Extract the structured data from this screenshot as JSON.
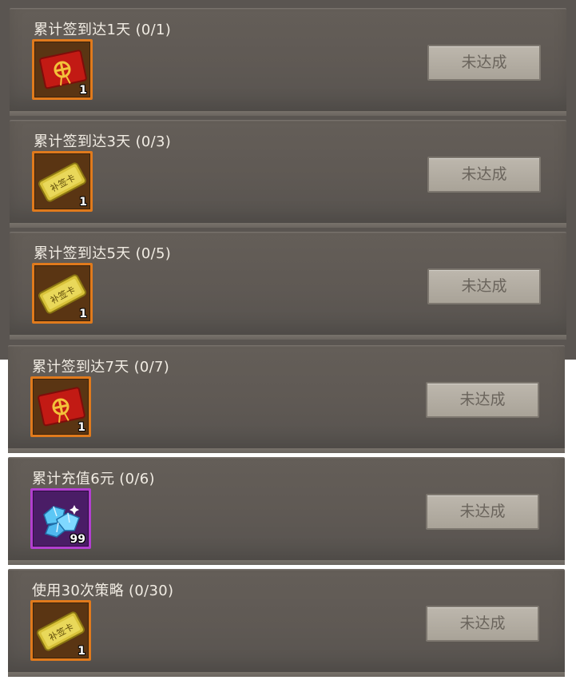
{
  "tasks": [
    {
      "title": "累计签到达1天 (0/1)",
      "reward_icon": "red-envelope-icon",
      "reward_count": "1",
      "status": "未达成"
    },
    {
      "title": "累计签到达3天 (0/3)",
      "reward_icon": "makeup-sign-card-icon",
      "reward_count": "1",
      "status": "未达成"
    },
    {
      "title": "累计签到达5天 (0/5)",
      "reward_icon": "makeup-sign-card-icon",
      "reward_count": "1",
      "status": "未达成"
    },
    {
      "title": "累计签到达7天 (0/7)",
      "reward_icon": "red-envelope-icon",
      "reward_count": "1",
      "status": "未达成"
    },
    {
      "title": "累计充值6元 (0/6)",
      "reward_icon": "diamond-gems-icon",
      "reward_count": "99",
      "status": "未达成"
    },
    {
      "title": "使用30次策略 (0/30)",
      "reward_icon": "makeup-sign-card-icon",
      "reward_count": "1",
      "status": "未达成"
    }
  ],
  "item_art": {
    "card_label": "补签卡"
  },
  "colors": {
    "panel": "#5f5954",
    "button": "#b3ada2",
    "button_text": "#6a645c",
    "rarity_orange": "#e07a1c",
    "rarity_purple": "#b23fd0"
  }
}
